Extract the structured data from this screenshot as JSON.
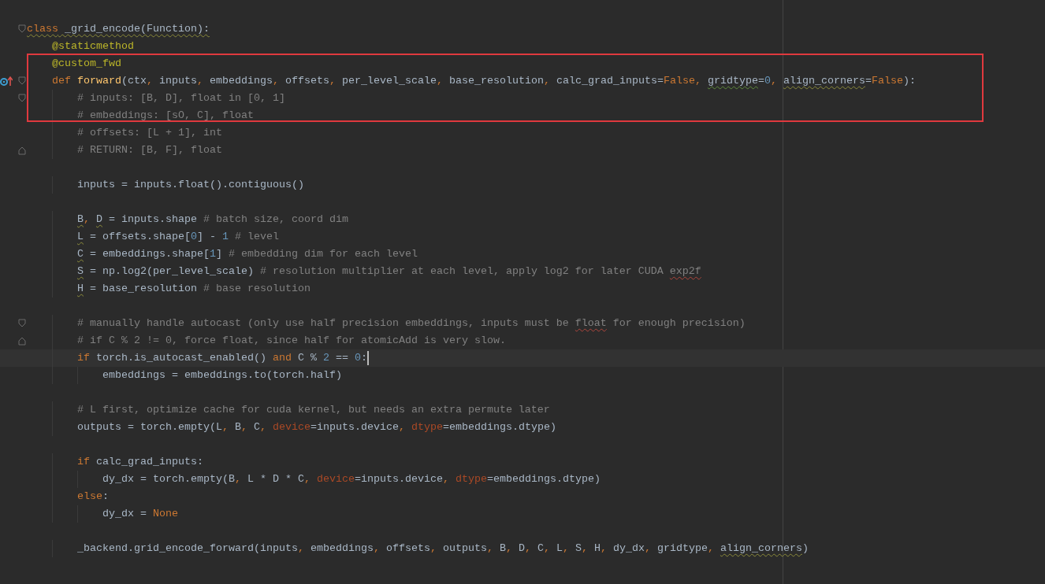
{
  "editor": {
    "lines": [
      {
        "kind": "code",
        "boxed": false,
        "current": false,
        "gutter_marks": [
          {
            "kind": "fold_start"
          }
        ],
        "tokens": [
          {
            "text": "class",
            "kind": "keyword_warning"
          },
          {
            "text": " _grid_encode(Function):",
            "kind": "plain_warning"
          }
        ],
        "children": [
          {
            "kind": "code",
            "boxed": false,
            "current": false,
            "tokens": [
              {
                "text": "@staticmethod",
                "kind": "decorator"
              }
            ]
          },
          {
            "kind": "code",
            "boxed": true,
            "current": false,
            "tokens": [
              {
                "text": "@custom_fwd",
                "kind": "decorator"
              }
            ]
          },
          {
            "kind": "code",
            "boxed": true,
            "current": false,
            "gutter_marks": [
              {
                "kind": "override"
              },
              {
                "kind": "fold_start"
              }
            ],
            "tokens": [
              {
                "text": "def ",
                "kind": "keyword"
              },
              {
                "text": "forward",
                "kind": "function"
              },
              {
                "text": "(ctx",
                "kind": "plain"
              },
              {
                "text": ", ",
                "kind": "keyword"
              },
              {
                "text": "inputs",
                "kind": "plain"
              },
              {
                "text": ", ",
                "kind": "keyword"
              },
              {
                "text": "embeddings",
                "kind": "plain"
              },
              {
                "text": ", ",
                "kind": "keyword"
              },
              {
                "text": "offsets",
                "kind": "plain"
              },
              {
                "text": ", ",
                "kind": "keyword"
              },
              {
                "text": "per_level_scale",
                "kind": "plain"
              },
              {
                "text": ", ",
                "kind": "keyword"
              },
              {
                "text": "base_resolution",
                "kind": "plain"
              },
              {
                "text": ", ",
                "kind": "keyword"
              },
              {
                "text": "calc_grad_inputs=",
                "kind": "plain"
              },
              {
                "text": "False",
                "kind": "keyword"
              },
              {
                "text": ", ",
                "kind": "keyword"
              },
              {
                "text": "gridtype",
                "kind": "plain_typo"
              },
              {
                "text": "=",
                "kind": "plain"
              },
              {
                "text": "0",
                "kind": "number"
              },
              {
                "text": ", ",
                "kind": "keyword"
              },
              {
                "text": "align_corners",
                "kind": "plain_warning"
              },
              {
                "text": "=",
                "kind": "plain"
              },
              {
                "text": "False",
                "kind": "keyword"
              },
              {
                "text": "):",
                "kind": "plain"
              }
            ],
            "children": [
              {
                "kind": "code",
                "boxed": true,
                "current": false,
                "gutter_marks": [
                  {
                    "kind": "fold_start"
                  }
                ],
                "tokens": [
                  {
                    "text": "# inputs: [B, D], float in [0, 1]",
                    "kind": "comment"
                  }
                ]
              },
              {
                "kind": "code",
                "boxed": true,
                "current": false,
                "tokens": [
                  {
                    "text": "# embeddings: [sO, C], float",
                    "kind": "comment"
                  }
                ]
              },
              {
                "kind": "code",
                "boxed": false,
                "current": false,
                "tokens": [
                  {
                    "text": "# offsets: [L + 1], int",
                    "kind": "comment"
                  }
                ]
              },
              {
                "kind": "code",
                "boxed": false,
                "current": false,
                "gutter_marks": [
                  {
                    "kind": "fold_end"
                  }
                ],
                "tokens": [
                  {
                    "text": "# RETURN: [B, F], float",
                    "kind": "comment"
                  }
                ]
              },
              {
                "kind": "blank"
              },
              {
                "kind": "code",
                "boxed": false,
                "current": false,
                "tokens": [
                  {
                    "text": "inputs = inputs.float().contiguous()",
                    "kind": "plain"
                  }
                ]
              },
              {
                "kind": "blank"
              },
              {
                "kind": "code",
                "boxed": false,
                "current": false,
                "tokens": [
                  {
                    "text": "B",
                    "kind": "plain_warning"
                  },
                  {
                    "text": ", ",
                    "kind": "keyword"
                  },
                  {
                    "text": "D",
                    "kind": "plain_warning"
                  },
                  {
                    "text": " = inputs.shape ",
                    "kind": "plain"
                  },
                  {
                    "text": "# batch size, coord dim",
                    "kind": "comment"
                  }
                ]
              },
              {
                "kind": "code",
                "boxed": false,
                "current": false,
                "tokens": [
                  {
                    "text": "L",
                    "kind": "plain_warning"
                  },
                  {
                    "text": " = offsets.shape[",
                    "kind": "plain"
                  },
                  {
                    "text": "0",
                    "kind": "number"
                  },
                  {
                    "text": "] - ",
                    "kind": "plain"
                  },
                  {
                    "text": "1",
                    "kind": "number"
                  },
                  {
                    "text": " # level",
                    "kind": "comment"
                  }
                ]
              },
              {
                "kind": "code",
                "boxed": false,
                "current": false,
                "tokens": [
                  {
                    "text": "C",
                    "kind": "plain_warning"
                  },
                  {
                    "text": " = embeddings.shape[",
                    "kind": "plain"
                  },
                  {
                    "text": "1",
                    "kind": "number"
                  },
                  {
                    "text": "] ",
                    "kind": "plain"
                  },
                  {
                    "text": "# embedding dim for each level",
                    "kind": "comment"
                  }
                ]
              },
              {
                "kind": "code",
                "boxed": false,
                "current": false,
                "tokens": [
                  {
                    "text": "S",
                    "kind": "plain_warning"
                  },
                  {
                    "text": " = np.log2(per_level_scale) ",
                    "kind": "plain"
                  },
                  {
                    "text": "# resolution multiplier at each level, apply log2 for later CUDA ",
                    "kind": "comment"
                  },
                  {
                    "text": "exp2f",
                    "kind": "comment_spelling"
                  }
                ]
              },
              {
                "kind": "code",
                "boxed": false,
                "current": false,
                "tokens": [
                  {
                    "text": "H",
                    "kind": "plain_warning"
                  },
                  {
                    "text": " = base_resolution ",
                    "kind": "plain"
                  },
                  {
                    "text": "# base resolution",
                    "kind": "comment"
                  }
                ]
              },
              {
                "kind": "blank"
              },
              {
                "kind": "code",
                "boxed": false,
                "current": false,
                "gutter_marks": [
                  {
                    "kind": "fold_start"
                  }
                ],
                "tokens": [
                  {
                    "text": "# manually handle autocast (only use half precision embeddings, inputs must be ",
                    "kind": "comment"
                  },
                  {
                    "text": "float",
                    "kind": "comment_spelling"
                  },
                  {
                    "text": " for enough precision)",
                    "kind": "comment"
                  }
                ]
              },
              {
                "kind": "code",
                "boxed": false,
                "current": false,
                "gutter_marks": [
                  {
                    "kind": "fold_end"
                  }
                ],
                "tokens": [
                  {
                    "text": "# if C % 2 != 0, force float, since half for atomicAdd is very slow.",
                    "kind": "comment"
                  }
                ]
              },
              {
                "kind": "code",
                "boxed": false,
                "current": true,
                "tokens": [
                  {
                    "text": "if",
                    "kind": "keyword"
                  },
                  {
                    "text": " torch.is_autocast_enabled() ",
                    "kind": "plain"
                  },
                  {
                    "text": "and",
                    "kind": "keyword"
                  },
                  {
                    "text": " C % ",
                    "kind": "plain"
                  },
                  {
                    "text": "2",
                    "kind": "number"
                  },
                  {
                    "text": " == ",
                    "kind": "plain"
                  },
                  {
                    "text": "0",
                    "kind": "number"
                  },
                  {
                    "text": ":",
                    "kind": "plain"
                  }
                ],
                "children": [
                  {
                    "kind": "code",
                    "boxed": false,
                    "current": false,
                    "tokens": [
                      {
                        "text": "embeddings = embeddings.to(torch.half)",
                        "kind": "plain"
                      }
                    ]
                  }
                ]
              },
              {
                "kind": "blank"
              },
              {
                "kind": "code",
                "boxed": false,
                "current": false,
                "tokens": [
                  {
                    "text": "# L first, optimize cache for cuda kernel, but needs an extra permute later",
                    "kind": "comment"
                  }
                ]
              },
              {
                "kind": "code",
                "boxed": false,
                "current": false,
                "tokens": [
                  {
                    "text": "outputs = torch.empty(L",
                    "kind": "plain"
                  },
                  {
                    "text": ", ",
                    "kind": "keyword"
                  },
                  {
                    "text": "B",
                    "kind": "plain"
                  },
                  {
                    "text": ", ",
                    "kind": "keyword"
                  },
                  {
                    "text": "C",
                    "kind": "plain"
                  },
                  {
                    "text": ", ",
                    "kind": "keyword"
                  },
                  {
                    "text": "device",
                    "kind": "parameter"
                  },
                  {
                    "text": "=inputs.device",
                    "kind": "plain"
                  },
                  {
                    "text": ", ",
                    "kind": "keyword"
                  },
                  {
                    "text": "dtype",
                    "kind": "parameter"
                  },
                  {
                    "text": "=embeddings.dtype)",
                    "kind": "plain"
                  }
                ]
              },
              {
                "kind": "blank"
              },
              {
                "kind": "code",
                "boxed": false,
                "current": false,
                "tokens": [
                  {
                    "text": "if",
                    "kind": "keyword"
                  },
                  {
                    "text": " calc_grad_inputs:",
                    "kind": "plain"
                  }
                ],
                "children": [
                  {
                    "kind": "code",
                    "boxed": false,
                    "current": false,
                    "tokens": [
                      {
                        "text": "dy_dx = torch.empty(B",
                        "kind": "plain"
                      },
                      {
                        "text": ", ",
                        "kind": "keyword"
                      },
                      {
                        "text": "L * D * C",
                        "kind": "plain"
                      },
                      {
                        "text": ", ",
                        "kind": "keyword"
                      },
                      {
                        "text": "device",
                        "kind": "parameter"
                      },
                      {
                        "text": "=inputs.device",
                        "kind": "plain"
                      },
                      {
                        "text": ", ",
                        "kind": "keyword"
                      },
                      {
                        "text": "dtype",
                        "kind": "parameter"
                      },
                      {
                        "text": "=embeddings.dtype)",
                        "kind": "plain"
                      }
                    ]
                  }
                ]
              },
              {
                "kind": "code",
                "boxed": false,
                "current": false,
                "tokens": [
                  {
                    "text": "else",
                    "kind": "keyword"
                  },
                  {
                    "text": ":",
                    "kind": "plain"
                  }
                ],
                "children": [
                  {
                    "kind": "code",
                    "boxed": false,
                    "current": false,
                    "tokens": [
                      {
                        "text": "dy_dx = ",
                        "kind": "plain"
                      },
                      {
                        "text": "None",
                        "kind": "keyword"
                      }
                    ]
                  }
                ]
              },
              {
                "kind": "blank"
              },
              {
                "kind": "code",
                "boxed": false,
                "current": false,
                "tokens": [
                  {
                    "text": "_backend.grid_encode_forward(inputs",
                    "kind": "plain"
                  },
                  {
                    "text": ", ",
                    "kind": "keyword"
                  },
                  {
                    "text": "embeddings",
                    "kind": "plain"
                  },
                  {
                    "text": ", ",
                    "kind": "keyword"
                  },
                  {
                    "text": "offsets",
                    "kind": "plain"
                  },
                  {
                    "text": ", ",
                    "kind": "keyword"
                  },
                  {
                    "text": "outputs",
                    "kind": "plain"
                  },
                  {
                    "text": ", ",
                    "kind": "keyword"
                  },
                  {
                    "text": "B",
                    "kind": "plain"
                  },
                  {
                    "text": ", ",
                    "kind": "keyword"
                  },
                  {
                    "text": "D",
                    "kind": "plain"
                  },
                  {
                    "text": ", ",
                    "kind": "keyword"
                  },
                  {
                    "text": "C",
                    "kind": "plain"
                  },
                  {
                    "text": ", ",
                    "kind": "keyword"
                  },
                  {
                    "text": "L",
                    "kind": "plain"
                  },
                  {
                    "text": ", ",
                    "kind": "keyword"
                  },
                  {
                    "text": "S",
                    "kind": "plain"
                  },
                  {
                    "text": ", ",
                    "kind": "keyword"
                  },
                  {
                    "text": "H",
                    "kind": "plain"
                  },
                  {
                    "text": ", ",
                    "kind": "keyword"
                  },
                  {
                    "text": "dy_dx",
                    "kind": "plain"
                  },
                  {
                    "text": ", ",
                    "kind": "keyword"
                  },
                  {
                    "text": "gridtype",
                    "kind": "plain"
                  },
                  {
                    "text": ", ",
                    "kind": "keyword"
                  },
                  {
                    "text": "align_corners",
                    "kind": "plain_warning"
                  },
                  {
                    "text": ")",
                    "kind": "plain"
                  }
                ]
              }
            ]
          }
        ]
      }
    ]
  }
}
